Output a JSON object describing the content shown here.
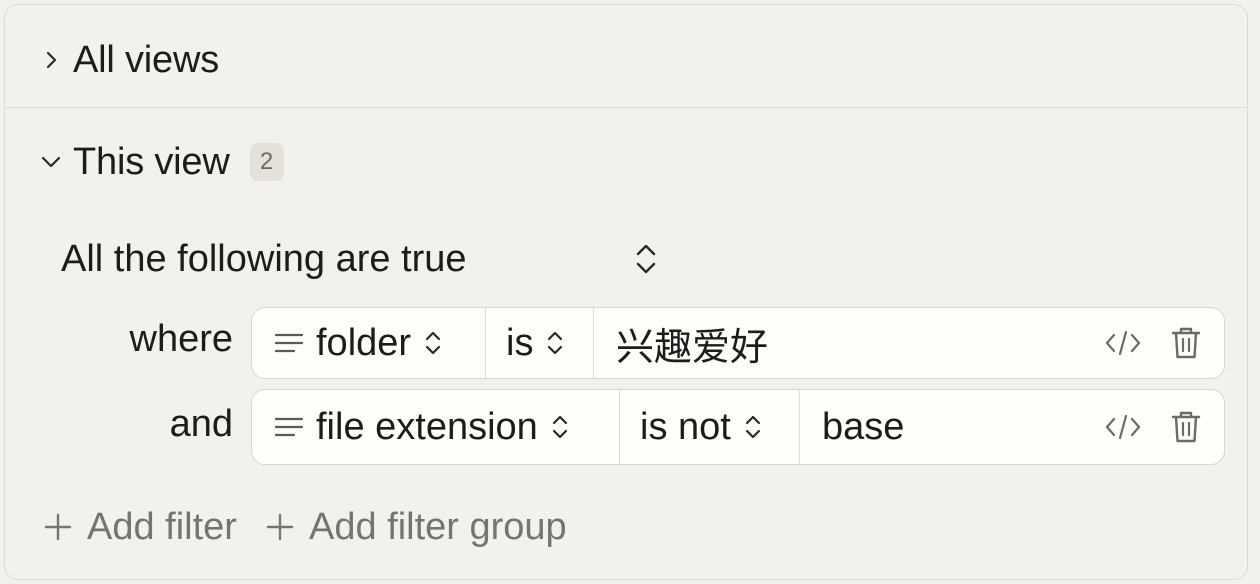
{
  "all_views": {
    "title": "All views",
    "expanded": false,
    "icon": "chevron-right-icon"
  },
  "this_view": {
    "title": "This view",
    "count": "2",
    "expanded": true,
    "icon": "chevron-down-icon"
  },
  "conjunction": {
    "label": "All the following are true",
    "icon": "updown-chevron-icon"
  },
  "filters": [
    {
      "connector": "where",
      "property": "folder",
      "property_icon": "text-lines-icon",
      "operator": "is",
      "value": "兴趣爱好"
    },
    {
      "connector": "and",
      "property": "file extension",
      "property_icon": "text-lines-icon",
      "operator": "is not",
      "value": "base"
    }
  ],
  "row_actions": {
    "code_icon": "code-icon",
    "delete_icon": "trash-icon"
  },
  "add": {
    "filter_label": "Add filter",
    "group_label": "Add filter group",
    "icon": "plus-icon"
  },
  "colors": {
    "background": "#f3f1eb",
    "row_background": "#fefdf7",
    "badge_background": "#e3e1da",
    "muted_text": "#75746f"
  }
}
